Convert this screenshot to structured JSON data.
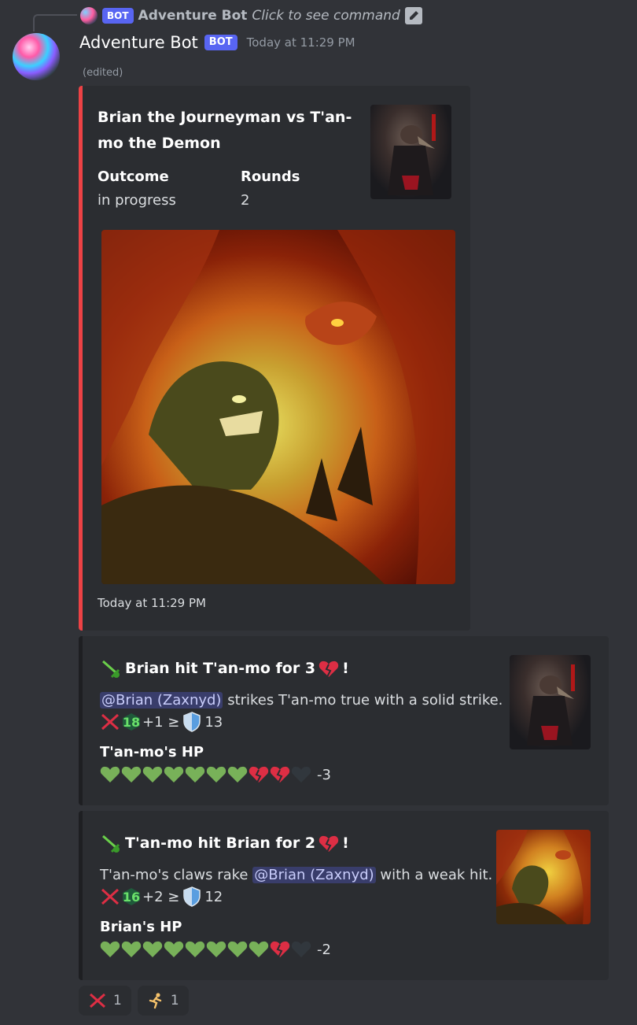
{
  "reply": {
    "bot_name": "Adventure Bot",
    "bot_tag": "BOT",
    "command_text": "Click to see command"
  },
  "message": {
    "author": "Adventure Bot",
    "bot_tag": "BOT",
    "timestamp": "Today at 11:29 PM",
    "edited": "(edited)"
  },
  "embed_main": {
    "title_line1": "Brian the Journeyman vs T'an-",
    "title_line2": "mo the Demon",
    "fields": [
      {
        "name": "Outcome",
        "value": "in progress"
      },
      {
        "name": "Rounds",
        "value": "2"
      }
    ],
    "footer": "Today at 11:29 PM",
    "accent": "#ed4245"
  },
  "embed_round1": {
    "title": "Brian hit T'an-mo for 3",
    "title_suffix": "!",
    "mention": "@Brian (Zaxnyd)",
    "desc_text": " strikes T'an-mo true with a solid strike.",
    "roll": "18",
    "modifier": "+1 ≥",
    "defense": "13",
    "hp_label": "T'an-mo's HP",
    "hp_full": 7,
    "hp_broken": 2,
    "hp_empty": 1,
    "hp_change": "-3"
  },
  "embed_round2": {
    "title": "T'an-mo hit Brian for 2",
    "title_suffix": "!",
    "desc_prefix": "T'an-mo's claws rake ",
    "mention": "@Brian (Zaxnyd)",
    "desc_text": " with a weak hit.",
    "roll": "16",
    "modifier": "+2 ≥",
    "defense": "12",
    "hp_label": "Brian's HP",
    "hp_full": 8,
    "hp_broken": 1,
    "hp_empty": 1,
    "hp_change": "-2"
  },
  "reactions": [
    {
      "icon": "crossed-swords-icon",
      "count": "1"
    },
    {
      "icon": "running-person-icon",
      "count": "1"
    }
  ]
}
